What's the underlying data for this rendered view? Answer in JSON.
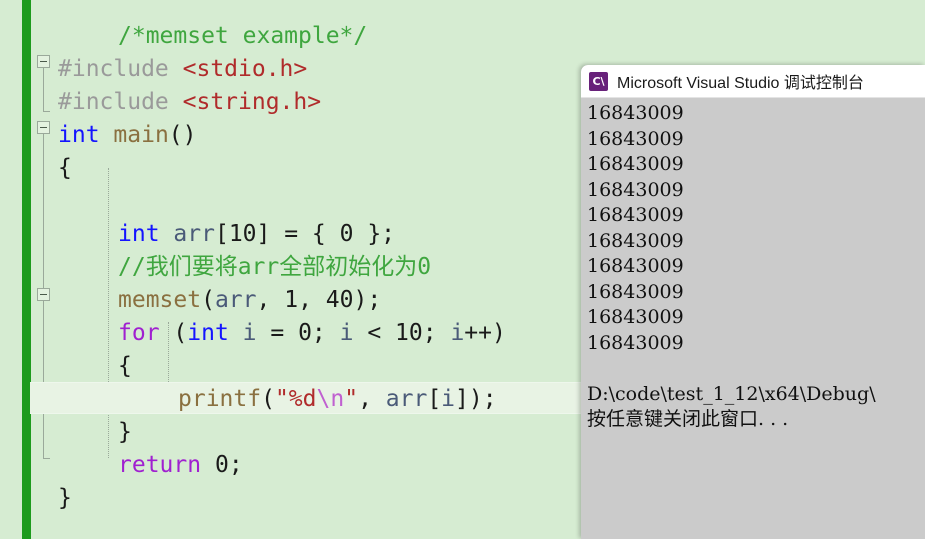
{
  "editor": {
    "theme_background": "#d6ecd2",
    "change_indicator_color": "#1d9b1d",
    "current_line_index": 12,
    "lines": [
      {
        "indent": 1,
        "tokens": [
          {
            "t": "/*memset example*/",
            "c": "tk-comment"
          }
        ]
      },
      {
        "indent": 0,
        "tokens": [
          {
            "t": "#include ",
            "c": "tk-pre"
          },
          {
            "t": "<stdio.h>",
            "c": "tk-inc"
          }
        ]
      },
      {
        "indent": 0,
        "tokens": [
          {
            "t": "#include ",
            "c": "tk-pre"
          },
          {
            "t": "<string.h>",
            "c": "tk-inc"
          }
        ]
      },
      {
        "indent": 0,
        "tokens": [
          {
            "t": "int",
            "c": "tk-kw"
          },
          {
            "t": " ",
            "c": "tk-plain"
          },
          {
            "t": "main",
            "c": "tk-fn"
          },
          {
            "t": "()",
            "c": "tk-plain"
          }
        ]
      },
      {
        "indent": 0,
        "tokens": [
          {
            "t": "{",
            "c": "tk-plain"
          }
        ]
      },
      {
        "indent": 0,
        "tokens": [
          {
            "t": "",
            "c": "tk-plain"
          }
        ]
      },
      {
        "indent": 1,
        "tokens": [
          {
            "t": "int",
            "c": "tk-kw"
          },
          {
            "t": " ",
            "c": "tk-plain"
          },
          {
            "t": "arr",
            "c": "tk-id"
          },
          {
            "t": "[",
            "c": "tk-plain"
          },
          {
            "t": "10",
            "c": "tk-num"
          },
          {
            "t": "] = { ",
            "c": "tk-plain"
          },
          {
            "t": "0",
            "c": "tk-num"
          },
          {
            "t": " };",
            "c": "tk-plain"
          }
        ]
      },
      {
        "indent": 1,
        "tokens": [
          {
            "t": "//我们要将arr全部初始化为0",
            "c": "tk-comment"
          }
        ]
      },
      {
        "indent": 1,
        "tokens": [
          {
            "t": "memset",
            "c": "tk-fn"
          },
          {
            "t": "(",
            "c": "tk-plain"
          },
          {
            "t": "arr",
            "c": "tk-id"
          },
          {
            "t": ", ",
            "c": "tk-plain"
          },
          {
            "t": "1",
            "c": "tk-num"
          },
          {
            "t": ", ",
            "c": "tk-plain"
          },
          {
            "t": "40",
            "c": "tk-num"
          },
          {
            "t": ");",
            "c": "tk-plain"
          }
        ]
      },
      {
        "indent": 1,
        "tokens": [
          {
            "t": "for",
            "c": "tk-kw2"
          },
          {
            "t": " (",
            "c": "tk-plain"
          },
          {
            "t": "int",
            "c": "tk-kw"
          },
          {
            "t": " ",
            "c": "tk-plain"
          },
          {
            "t": "i",
            "c": "tk-id"
          },
          {
            "t": " = ",
            "c": "tk-plain"
          },
          {
            "t": "0",
            "c": "tk-num"
          },
          {
            "t": "; ",
            "c": "tk-plain"
          },
          {
            "t": "i",
            "c": "tk-id"
          },
          {
            "t": " < ",
            "c": "tk-plain"
          },
          {
            "t": "10",
            "c": "tk-num"
          },
          {
            "t": "; ",
            "c": "tk-plain"
          },
          {
            "t": "i",
            "c": "tk-id"
          },
          {
            "t": "++)",
            "c": "tk-plain"
          }
        ]
      },
      {
        "indent": 1,
        "tokens": [
          {
            "t": "{",
            "c": "tk-plain"
          }
        ]
      },
      {
        "indent": 2,
        "tokens": [
          {
            "t": "printf",
            "c": "tk-fn"
          },
          {
            "t": "(",
            "c": "tk-plain"
          },
          {
            "t": "\"%d",
            "c": "tk-str"
          },
          {
            "t": "\\n",
            "c": "tk-esc"
          },
          {
            "t": "\"",
            "c": "tk-str"
          },
          {
            "t": ", ",
            "c": "tk-plain"
          },
          {
            "t": "arr",
            "c": "tk-id"
          },
          {
            "t": "[",
            "c": "tk-plain"
          },
          {
            "t": "i",
            "c": "tk-id"
          },
          {
            "t": "]);",
            "c": "tk-plain"
          }
        ]
      },
      {
        "indent": 1,
        "tokens": [
          {
            "t": "}",
            "c": "tk-plain"
          }
        ]
      },
      {
        "indent": 1,
        "tokens": [
          {
            "t": "return",
            "c": "tk-kw2"
          },
          {
            "t": " ",
            "c": "tk-plain"
          },
          {
            "t": "0",
            "c": "tk-num"
          },
          {
            "t": ";",
            "c": "tk-plain"
          }
        ]
      },
      {
        "indent": 0,
        "tokens": [
          {
            "t": "}",
            "c": "tk-plain"
          }
        ]
      }
    ]
  },
  "console": {
    "icon_name": "visual-studio-console-icon",
    "icon_glyph": "C\\",
    "title": "Microsoft Visual Studio 调试控制台",
    "output_lines": [
      "16843009",
      "16843009",
      "16843009",
      "16843009",
      "16843009",
      "16843009",
      "16843009",
      "16843009",
      "16843009",
      "16843009",
      "",
      "D:\\code\\test_1_12\\x64\\Debug\\",
      "按任意键关闭此窗口. . ."
    ]
  }
}
